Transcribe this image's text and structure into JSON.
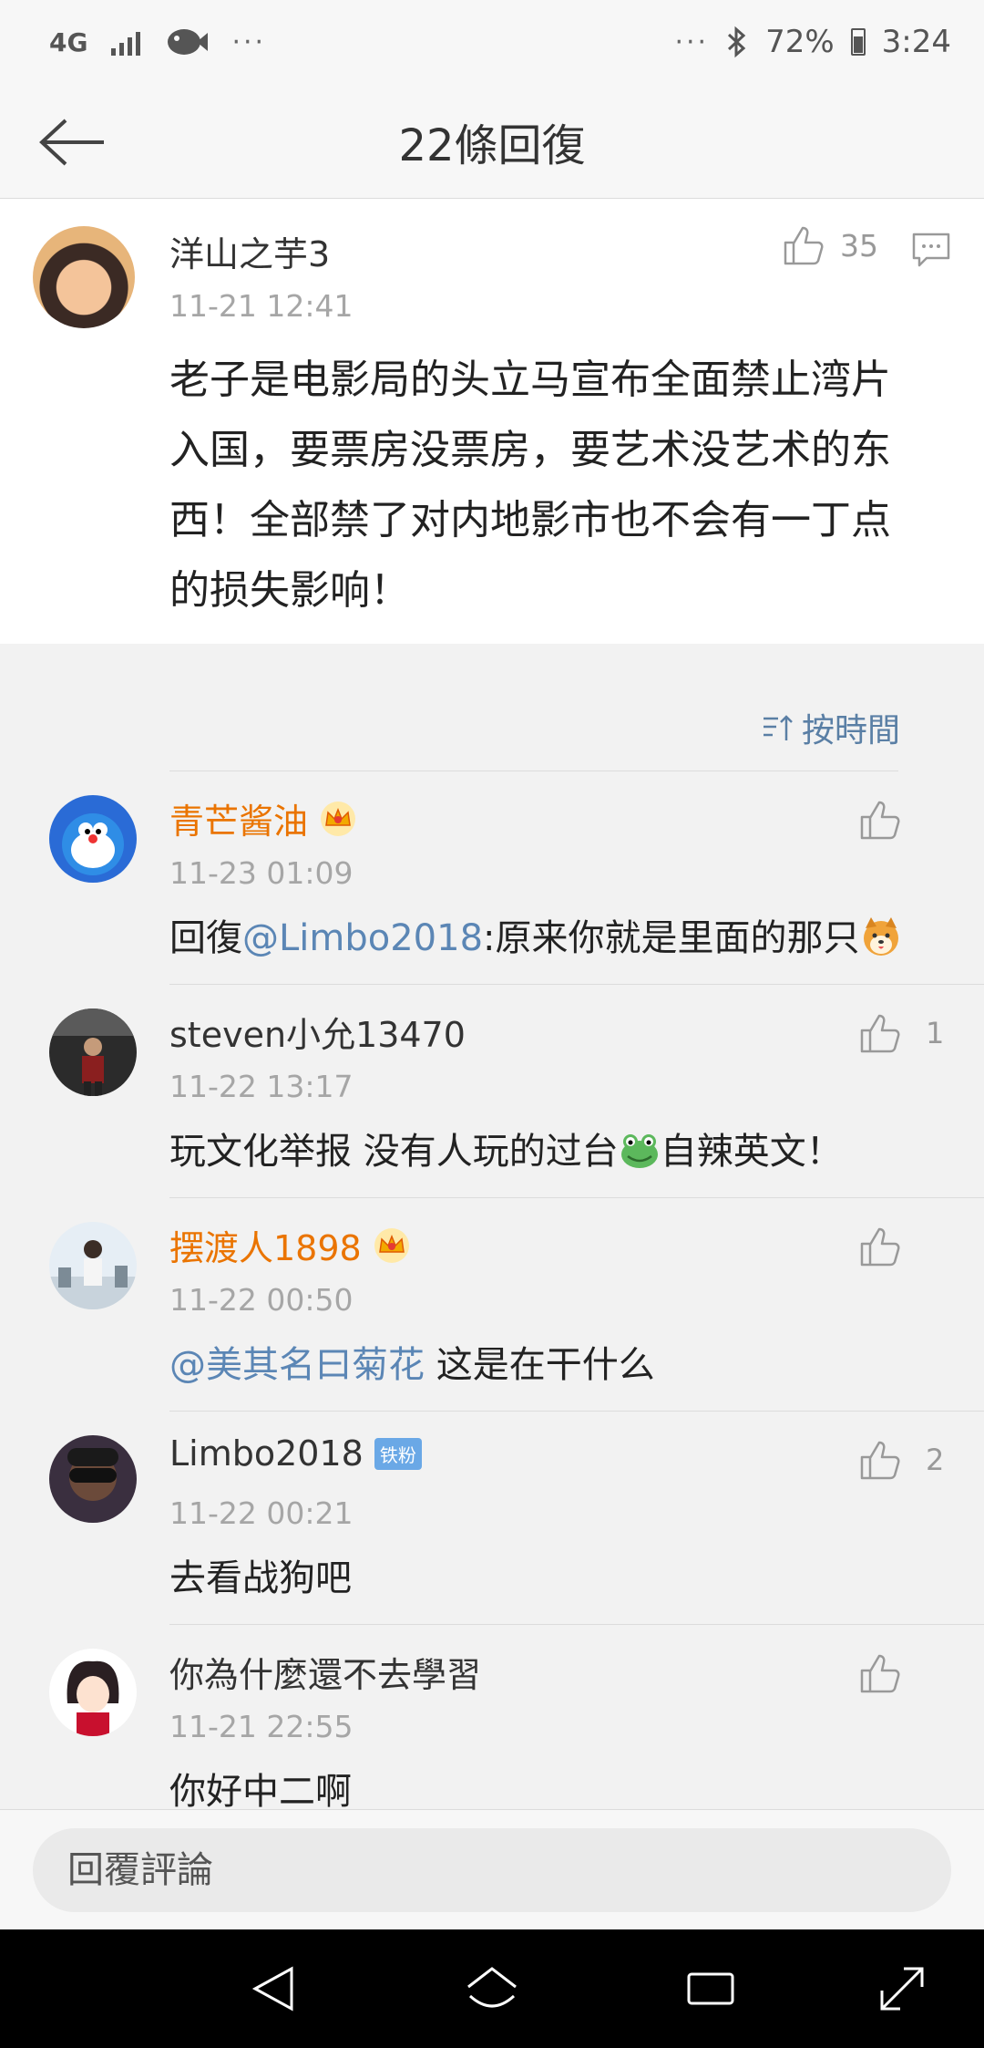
{
  "status_bar": {
    "network": "4G",
    "dots_left": "···",
    "dots_right": "···",
    "battery": "72%",
    "time": "3:24"
  },
  "nav": {
    "title": "22條回復"
  },
  "main_post": {
    "author": "洋山之芋3",
    "time": "11-21 12:41",
    "likes": "35",
    "text": "老子是电影局的头立马宣布全面禁止湾片入国，要票房没票房，要艺术没艺术的东西！全部禁了对内地影市也不会有一丁点的损失影响！"
  },
  "sort": {
    "label": "按時間"
  },
  "replies": [
    {
      "name": "青芒酱油",
      "time": "11-23 01:09",
      "text_prefix": "回復",
      "mention": "@Limbo2018",
      "text_suffix": ":原来你就是里面的那只",
      "likes": ""
    },
    {
      "name": "steven小允13470",
      "time": "11-22 13:17",
      "text_prefix": "玩文化举报 没有人玩的过台",
      "text_suffix": "自辣英文！",
      "likes": "1"
    },
    {
      "name": "摆渡人1898",
      "time": "11-22 00:50",
      "mention": "@美其名曰菊花",
      "text_suffix": " 这是在干什么",
      "likes": ""
    },
    {
      "name": "Limbo2018",
      "badge": "铁粉",
      "time": "11-22 00:21",
      "text": "去看战狗吧",
      "likes": "2"
    },
    {
      "name": "你為什麼還不去學習",
      "time": "11-21 22:55",
      "text": "你好中二啊",
      "likes": ""
    }
  ],
  "input": {
    "placeholder": "回覆評論"
  },
  "colors": {
    "vip_name": "#ea7400",
    "link": "#5b86b5",
    "sort": "#5a7fa5"
  }
}
